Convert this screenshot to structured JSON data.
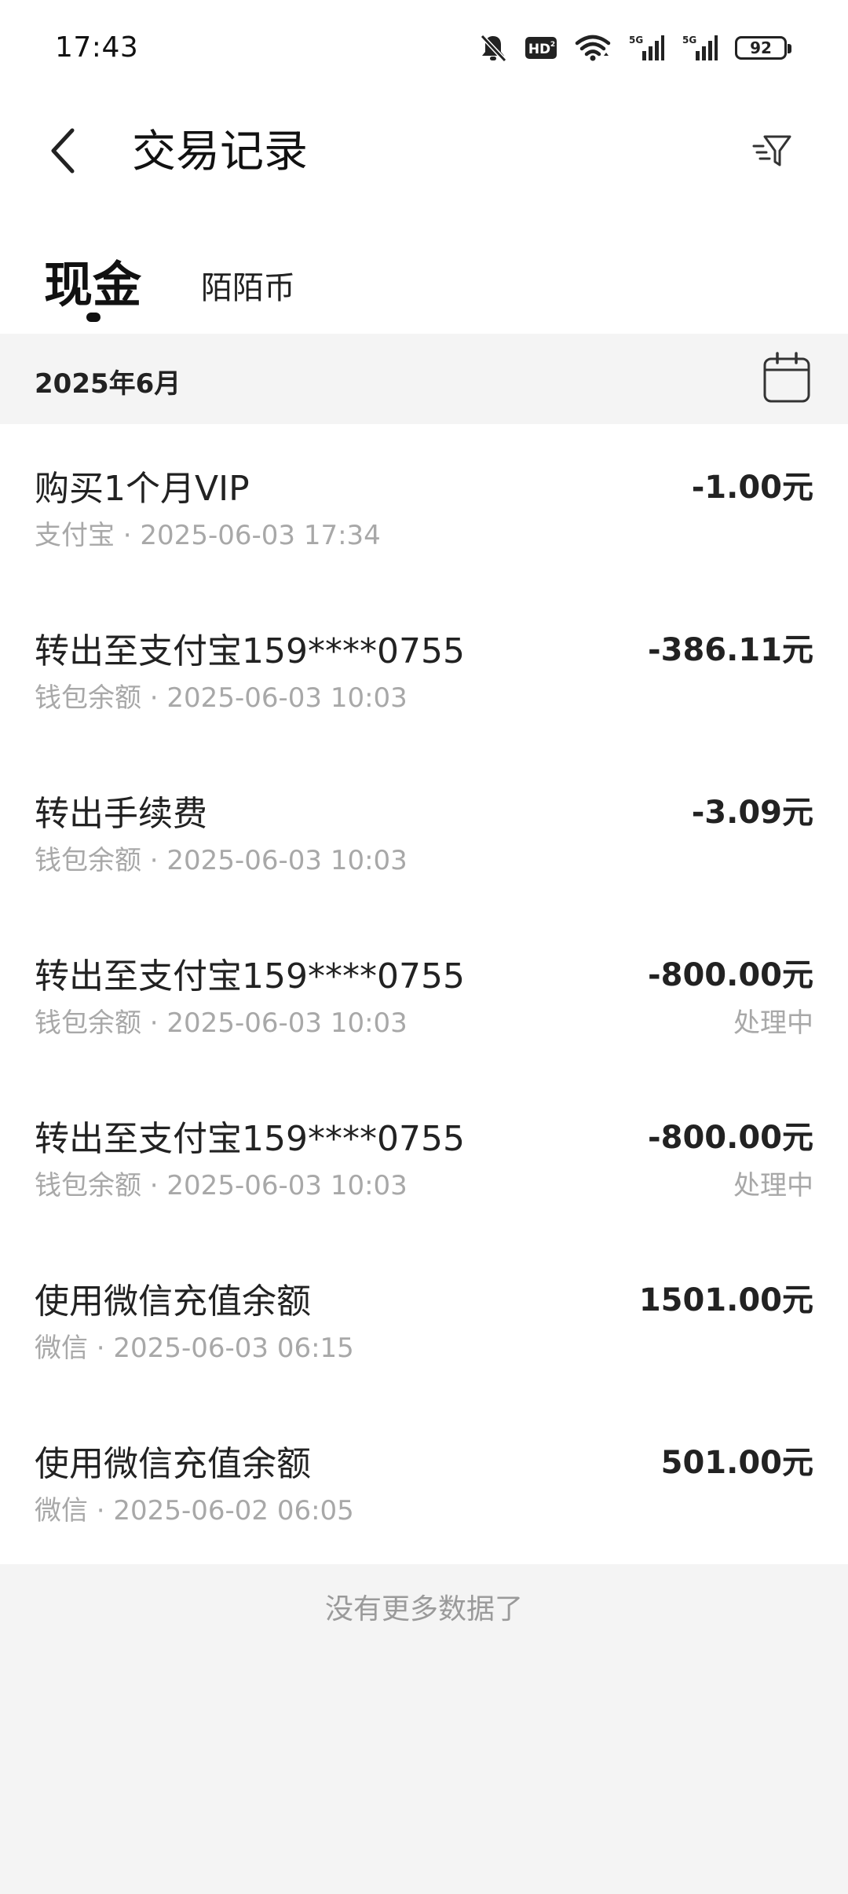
{
  "status_bar": {
    "time": "17:43",
    "battery": "92",
    "icons": [
      "mute-bell-icon",
      "hd-icon",
      "wifi-icon",
      "signal-5g-icon",
      "signal-5g-icon",
      "battery-icon"
    ]
  },
  "header": {
    "title": "交易记录",
    "back_icon": "chevron-left-icon",
    "filter_icon": "filter-icon"
  },
  "tabs": [
    {
      "label": "现金",
      "active": true
    },
    {
      "label": "陌陌币",
      "active": false
    }
  ],
  "month_section": {
    "label": "2025年6月",
    "calendar_icon": "calendar-icon"
  },
  "transactions": [
    {
      "title": "购买1个月VIP",
      "subtitle": "支付宝 · 2025-06-03 17:34",
      "amount": "-1.00元",
      "status": ""
    },
    {
      "title": "转出至支付宝159****0755",
      "subtitle": "钱包余额 · 2025-06-03 10:03",
      "amount": "-386.11元",
      "status": ""
    },
    {
      "title": "转出手续费",
      "subtitle": "钱包余额 · 2025-06-03 10:03",
      "amount": "-3.09元",
      "status": ""
    },
    {
      "title": "转出至支付宝159****0755",
      "subtitle": "钱包余额 · 2025-06-03 10:03",
      "amount": "-800.00元",
      "status": "处理中"
    },
    {
      "title": "转出至支付宝159****0755",
      "subtitle": "钱包余额 · 2025-06-03 10:03",
      "amount": "-800.00元",
      "status": "处理中"
    },
    {
      "title": "使用微信充值余额",
      "subtitle": "微信 · 2025-06-03 06:15",
      "amount": "1501.00元",
      "status": ""
    },
    {
      "title": "使用微信充值余额",
      "subtitle": "微信 · 2025-06-02 06:05",
      "amount": "501.00元",
      "status": ""
    }
  ],
  "footer": {
    "no_more_text": "没有更多数据了"
  },
  "colors": {
    "background": "#f4f4f4",
    "surface": "#ffffff",
    "text_primary": "#222222",
    "text_secondary": "#a8a8a8"
  }
}
